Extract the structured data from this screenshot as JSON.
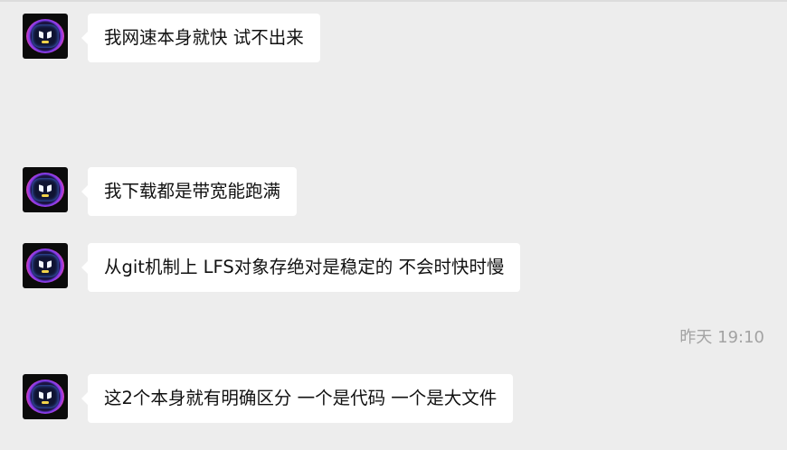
{
  "messages": [
    {
      "text": "我网速本身就快 试不出来",
      "sender": "other"
    },
    {
      "text": "我下载都是带宽能跑满",
      "sender": "other"
    },
    {
      "text": "从git机制上 LFS对象存绝对是稳定的 不会时快时慢",
      "sender": "other"
    },
    {
      "text": "这2个本身就有明确区分 一个是代码 一个是大文件",
      "sender": "other"
    }
  ],
  "timestamp": "昨天 19:10",
  "colors": {
    "background": "#ededed",
    "bubble": "#ffffff",
    "text": "#111111",
    "timestamp": "#a3a3a3"
  }
}
